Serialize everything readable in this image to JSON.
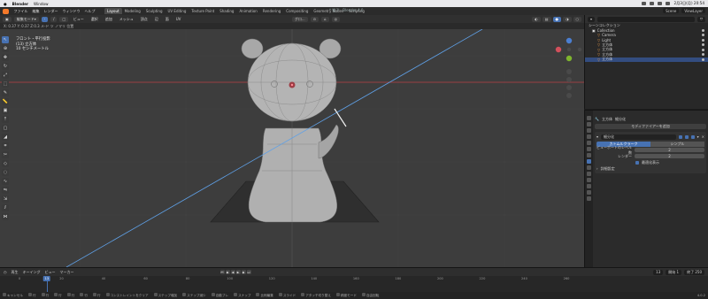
{
  "macbar": {
    "app_name": "Blender",
    "menu_window": "Window",
    "clock": "2月3日(月)  20:54"
  },
  "topbar": {
    "menus": [
      "ファイル",
      "編集",
      "レンダー",
      "ウィンドウ",
      "ヘルプ"
    ],
    "workspaces": [
      "Layout",
      "Modeling",
      "Sculpting",
      "UV Editing",
      "Texture Paint",
      "Shading",
      "Animation",
      "Rendering",
      "Compositing",
      "Geometry Nodes",
      "Scripting"
    ],
    "active_workspace": "Layout",
    "window_title": "* 猫子 - Blender 4.0",
    "scene_label": "Scene",
    "view_layer_label": "ViewLayer"
  },
  "viewport_header": {
    "mode": "編集モード",
    "menus": [
      "ビュー",
      "選択",
      "追加",
      "メッシュ",
      "頂点",
      "辺",
      "面",
      "UV"
    ],
    "transform_orientation": "グロ..."
  },
  "viewport_sub": {
    "text": "X: 0.37 Y: 0.37   Z:0.3 メ-ド   ツ ノマリ 位置"
  },
  "viewport_info": {
    "line1": "フロント・平行投影",
    "line2": "(13) 立方体",
    "line3": "10 センチメートル"
  },
  "toolbar": {
    "tools": [
      "select-tool",
      "cursor-tool",
      "move-tool",
      "rotate-tool",
      "scale-tool",
      "transform-tool",
      "annotate-tool",
      "measure-tool",
      "add-cube-tool",
      "extrude-tool",
      "inset-tool",
      "bevel-tool",
      "loop-cut-tool",
      "knife-tool",
      "poly-build-tool",
      "spin-tool",
      "smooth-tool",
      "edge-slide-tool",
      "shrink-tool",
      "shear-tool",
      "rip-tool"
    ]
  },
  "outliner": {
    "search_placeholder": "",
    "root": "シーンコレクション",
    "rows": [
      {
        "name": "Collection",
        "selected": false
      },
      {
        "name": "Camera",
        "selected": false
      },
      {
        "name": "Light",
        "selected": false
      },
      {
        "name": "立方体",
        "selected": false
      },
      {
        "name": "立方体",
        "selected": false
      },
      {
        "name": "立方体",
        "selected": false
      },
      {
        "name": "立方体",
        "selected": true
      }
    ]
  },
  "properties": {
    "object_name": "立方体",
    "modifier_name": "細分化",
    "add_modifier_label": "モディファイアーを追加",
    "mod_header_name": "細分化",
    "tabs": [
      "カトムルクラーク",
      "シンプル"
    ],
    "viewport_levels_label": "ビューポートのレベル数",
    "viewport_levels_value": "2",
    "render_label": "レンダー",
    "render_value": "2",
    "optimal_display_label": "最適化表示",
    "advanced_label": "詳細設定"
  },
  "timeline": {
    "menus": [
      "再生",
      "キーイング",
      "ビュー",
      "マーカー"
    ],
    "current_frame": "13",
    "start_label": "開始",
    "start_value": "1",
    "end_label": "終了",
    "end_value": "250",
    "ruler_ticks": [
      "0",
      "20",
      "40",
      "60",
      "80",
      "100",
      "120",
      "140",
      "160",
      "180",
      "200",
      "220",
      "240",
      "260"
    ]
  },
  "status": {
    "items": [
      "キャンセル",
      "行",
      "行",
      "行",
      "行",
      "行",
      "行",
      "コンストレイントをクリア",
      "ステップ増加",
      "ステップ減少",
      "自動ブレ",
      "スナップ",
      "比例編集",
      "スライド",
      "アタッチ切り替え",
      "精度モード",
      "自由回転"
    ],
    "version": "4.0.2"
  },
  "colors": {
    "accent": "#4772b3",
    "viewport_bg": "#3d3d3d",
    "x_axis": "#b83f47",
    "y_axis": "#7fb52e",
    "selection_line": "#5fa0e6",
    "blender_orange": "#f5792a"
  }
}
